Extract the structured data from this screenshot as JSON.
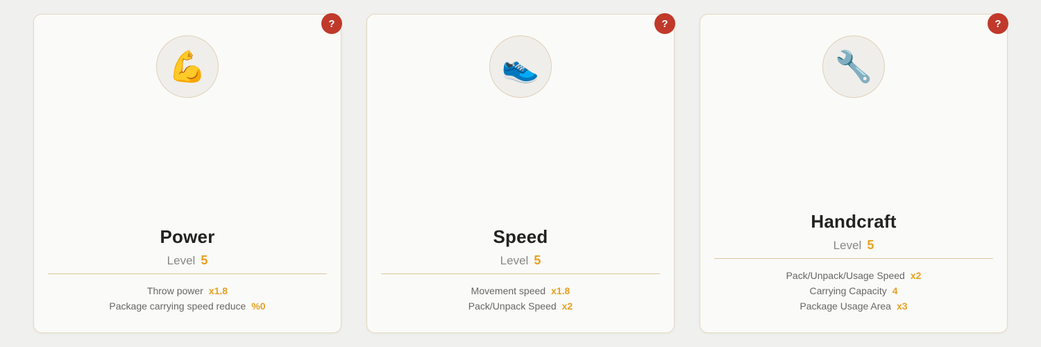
{
  "cards": [
    {
      "id": "power",
      "title": "Power",
      "icon": "💪",
      "level_label": "Level",
      "level_value": "5",
      "help_label": "?",
      "stats": [
        {
          "label": "Throw power",
          "value": "x1.8"
        },
        {
          "label": "Package carrying speed reduce",
          "value": "%0"
        }
      ]
    },
    {
      "id": "speed",
      "title": "Speed",
      "icon": "👟",
      "level_label": "Level",
      "level_value": "5",
      "help_label": "?",
      "stats": [
        {
          "label": "Movement speed",
          "value": "x1.8"
        },
        {
          "label": "Pack/Unpack Speed",
          "value": "x2"
        }
      ]
    },
    {
      "id": "handcraft",
      "title": "Handcraft",
      "icon": "🔧",
      "level_label": "Level",
      "level_value": "5",
      "help_label": "?",
      "stats": [
        {
          "label": "Pack/Unpack/Usage Speed",
          "value": "x2"
        },
        {
          "label": "Carrying Capacity",
          "value": "4"
        },
        {
          "label": "Package Usage Area",
          "value": "x3"
        }
      ]
    }
  ]
}
